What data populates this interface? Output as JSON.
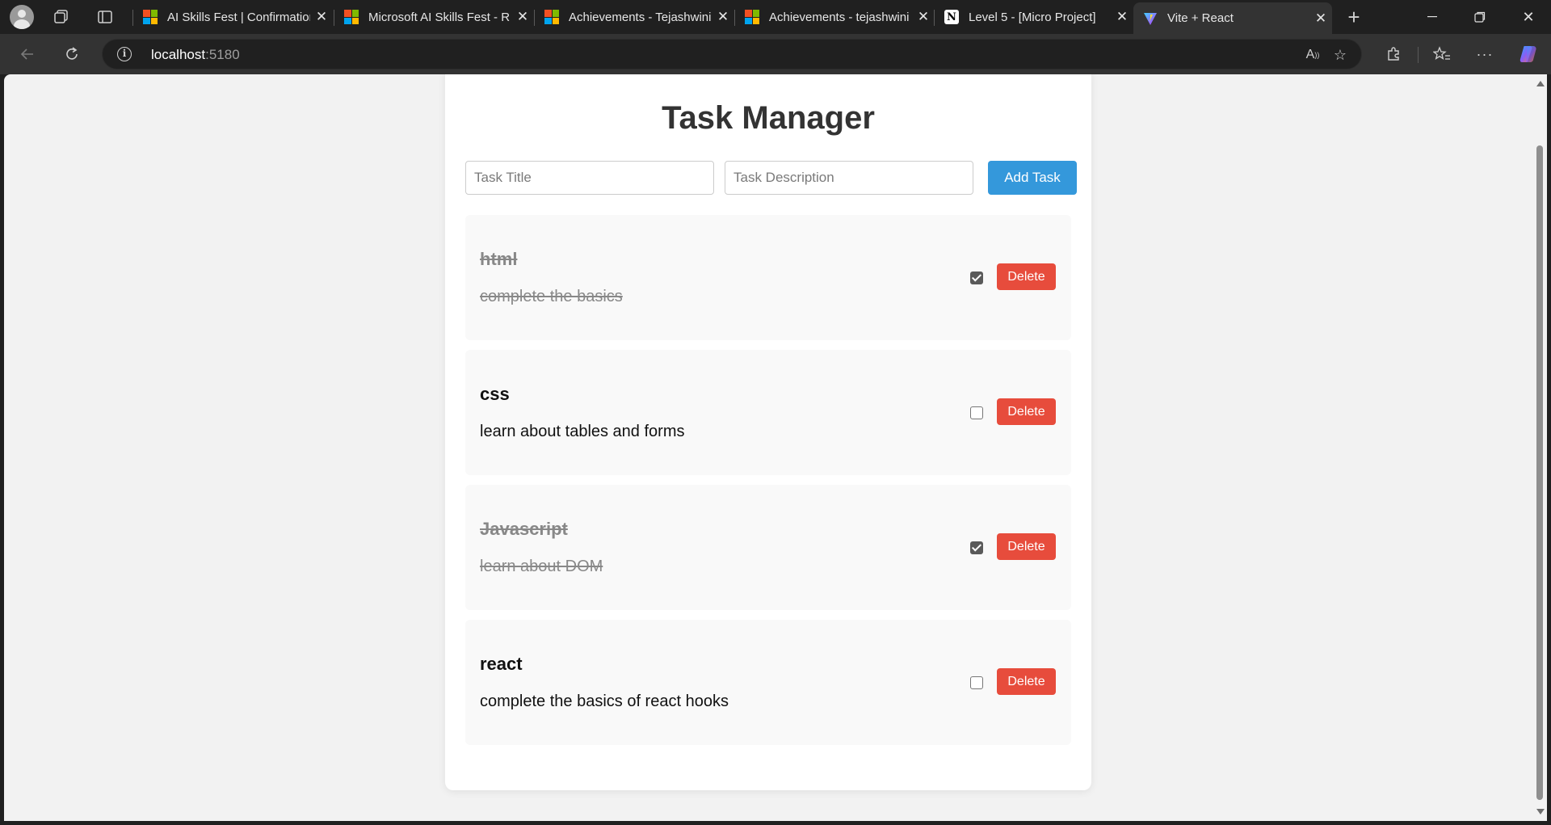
{
  "browser": {
    "tabs": [
      {
        "title": "AI Skills Fest | Confirmation",
        "favicon": "microsoft-logo"
      },
      {
        "title": "Microsoft AI Skills Fest - R",
        "favicon": "microsoft-logo"
      },
      {
        "title": "Achievements - Tejashwini",
        "favicon": "microsoft-logo"
      },
      {
        "title": "Achievements - tejashwini",
        "favicon": "microsoft-logo"
      },
      {
        "title": "Level 5 - [Micro Project]",
        "favicon": "notion-logo"
      },
      {
        "title": "Vite + React",
        "favicon": "vite-logo",
        "active": true
      }
    ],
    "url_host": "localhost",
    "url_port": ":5180"
  },
  "app": {
    "title": "Task Manager",
    "title_placeholder": "Task Title",
    "description_placeholder": "Task Description",
    "add_button": "Add Task",
    "delete_label": "Delete",
    "tasks": [
      {
        "title": "html",
        "description": "complete the basics",
        "completed": true
      },
      {
        "title": "css",
        "description": "learn about tables and forms",
        "completed": false
      },
      {
        "title": "Javascript",
        "description": "learn about DOM",
        "completed": true
      },
      {
        "title": "react",
        "description": "complete the basics of react hooks",
        "completed": false
      }
    ]
  },
  "colors": {
    "accent_blue": "#3498db",
    "delete_red": "#e74c3c",
    "completed_gray": "#888888"
  }
}
